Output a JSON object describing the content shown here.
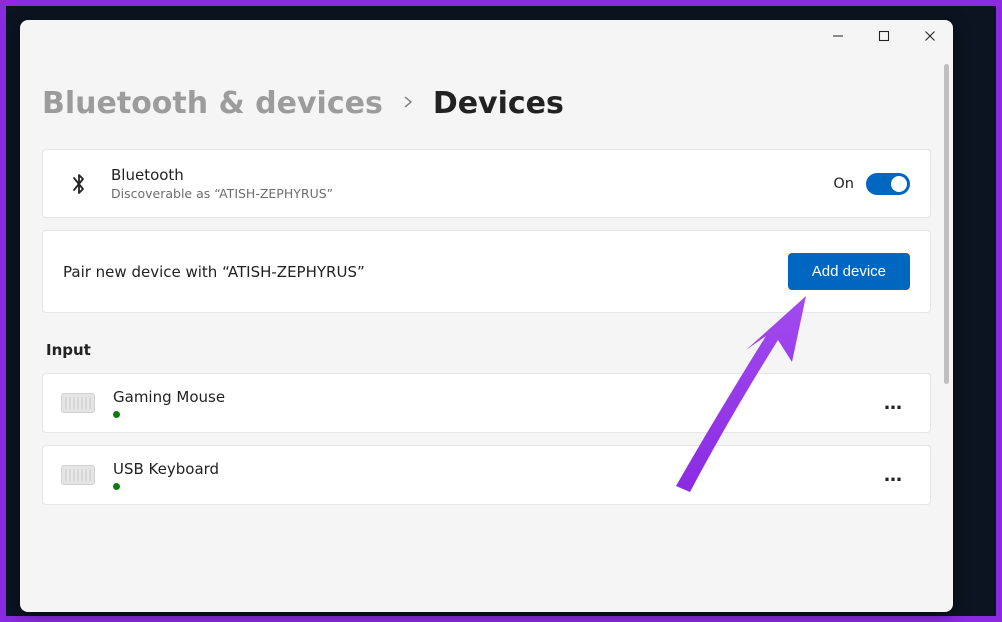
{
  "breadcrumb": {
    "parent": "Bluetooth & devices",
    "current": "Devices"
  },
  "bluetooth_card": {
    "title": "Bluetooth",
    "subtitle": "Discoverable as “ATISH-ZEPHYRUS”",
    "state_label": "On"
  },
  "pair_card": {
    "text": "Pair new device with “ATISH-ZEPHYRUS”",
    "button": "Add device"
  },
  "sections": {
    "input_header": "Input"
  },
  "devices": [
    {
      "name": "Gaming Mouse"
    },
    {
      "name": "USB Keyboard"
    }
  ],
  "colors": {
    "accent": "#0067c0",
    "annotation": "#8a2be2",
    "status_ok": "#107c10"
  }
}
